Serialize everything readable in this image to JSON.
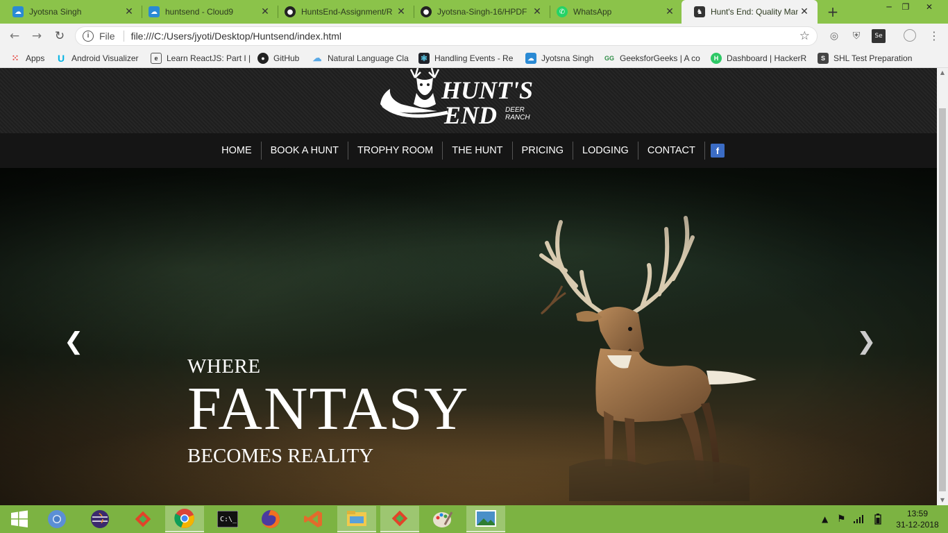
{
  "browser": {
    "tabs": [
      {
        "title": "Jyotsna Singh",
        "icon": "cloud9-icon"
      },
      {
        "title": "huntsend - Cloud9",
        "icon": "cloud9-icon"
      },
      {
        "title": "HuntsEnd-Assignment/R",
        "icon": "github-icon"
      },
      {
        "title": "Jyotsna-Singh-16/HPDF",
        "icon": "github-icon"
      },
      {
        "title": "WhatsApp",
        "icon": "whatsapp-icon"
      },
      {
        "title": "Hunt's End: Quality Man",
        "icon": "site-icon",
        "active": true
      }
    ],
    "url_scheme": "File",
    "url": "file:///C:/Users/jyoti/Desktop/Huntsend/index.html",
    "bookmarks": [
      {
        "label": "Apps",
        "icon": "apps-grid-icon"
      },
      {
        "label": "Android Visualizer",
        "icon": "udacity-icon"
      },
      {
        "label": "Learn ReactJS: Part I |",
        "icon": "page-icon"
      },
      {
        "label": "GitHub",
        "icon": "github-icon"
      },
      {
        "label": "Natural Language Cla",
        "icon": "cloud-icon"
      },
      {
        "label": "Handling Events - Re",
        "icon": "react-icon"
      },
      {
        "label": "Jyotsna Singh",
        "icon": "cloud9-icon"
      },
      {
        "label": "GeeksforGeeks | A co",
        "icon": "gfg-icon"
      },
      {
        "label": "Dashboard | HackerR",
        "icon": "hackerrank-icon"
      },
      {
        "label": "SHL Test Preparation",
        "icon": "shl-icon"
      }
    ]
  },
  "site": {
    "logo": {
      "line1": "HUNT'S",
      "line2": "END",
      "sub1": "DEER",
      "sub2": "RANCH"
    },
    "nav": [
      "HOME",
      "BOOK A HUNT",
      "TROPHY ROOM",
      "THE HUNT",
      "PRICING",
      "LODGING",
      "CONTACT"
    ],
    "facebook": "f",
    "hero": {
      "line1": "WHERE",
      "line2": "FANTASY",
      "line3": "BECOMES REALITY",
      "prev": "❮",
      "next": "❯"
    }
  },
  "taskbar": {
    "apps": [
      "start-icon",
      "chromium-icon",
      "eclipse-icon",
      "git-gui-icon",
      "chrome-icon",
      "terminal-icon",
      "firefox-icon",
      "visual-studio-icon",
      "file-explorer-icon",
      "git-gui-icon",
      "paint-icon",
      "photos-icon"
    ],
    "time": "13:59",
    "date": "31-12-2018"
  }
}
